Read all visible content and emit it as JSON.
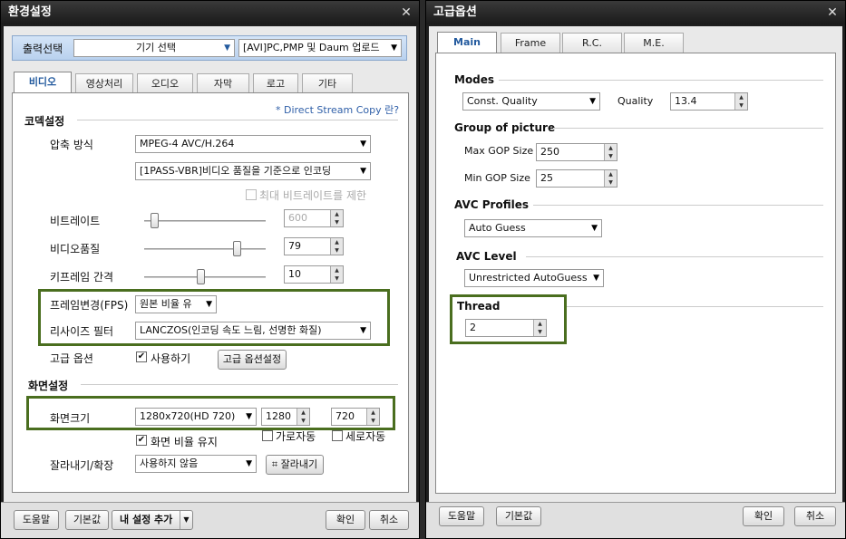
{
  "left": {
    "title": "환경설정",
    "output_label": "출력선택",
    "device_select": "기기 선택",
    "output_target": "[AVI]PC,PMP 및 Daum 업로드",
    "tabs": [
      "비디오",
      "영상처리",
      "오디오",
      "자막",
      "로고",
      "기타"
    ],
    "codec_section": "코덱설정",
    "direct_stream": "* Direct Stream Copy 란?",
    "compression_label": "압축 방식",
    "compression_value": "MPEG-4 AVC/H.264",
    "encoding_mode": "[1PASS-VBR]비디오 품질을 기준으로 인코딩",
    "limit_bitrate": "최대 비트레이트를 제한",
    "bitrate_label": "비트레이트",
    "bitrate_value": "600",
    "quality_label": "비디오품질",
    "quality_value": "79",
    "keyframe_label": "키프레임 간격",
    "keyframe_value": "10",
    "fps_label": "프레임변경(FPS)",
    "fps_value": "원본 비율 유",
    "resize_label": "리사이즈 필터",
    "resize_value": "LANCZOS(인코딩 속도 느림, 선명한 화질)",
    "advanced_label": "고급 옵션",
    "use_label": "사용하기",
    "advanced_btn": "고급 옵션설정",
    "screen_section": "화면설정",
    "size_label": "화면크기",
    "size_value": "1280x720(HD 720)",
    "width_value": "1280",
    "height_value": "720",
    "keep_ratio": "화면 비율 유지",
    "auto_w": "가로자동",
    "auto_h": "세로자동",
    "crop_label": "잘라내기/확장",
    "crop_value": "사용하지 않음",
    "crop_btn": "잘라내기",
    "help_btn": "도움말",
    "default_btn": "기본값",
    "my_settings_btn": "내 설정 추가",
    "ok_btn": "확인",
    "cancel_btn": "취소"
  },
  "right": {
    "title": "고급옵션",
    "tabs": [
      "Main",
      "Frame",
      "R.C.",
      "M.E."
    ],
    "modes_section": "Modes",
    "mode_value": "Const. Quality",
    "quality_label": "Quality",
    "quality_value": "13.4",
    "gop_section": "Group of picture",
    "max_gop_label": "Max GOP Size",
    "max_gop_value": "250",
    "min_gop_label": "Min GOP Size",
    "min_gop_value": "25",
    "profiles_section": "AVC Profiles",
    "profile_value": "Auto Guess",
    "level_section": "AVC Level",
    "level_value": "Unrestricted AutoGuess",
    "thread_section": "Thread",
    "thread_value": "2",
    "help_btn": "도움말",
    "default_btn": "기본값",
    "ok_btn": "확인",
    "cancel_btn": "취소"
  },
  "colors": {
    "highlight": "#4a6e1f",
    "tab_active_text": "#235a9e"
  }
}
